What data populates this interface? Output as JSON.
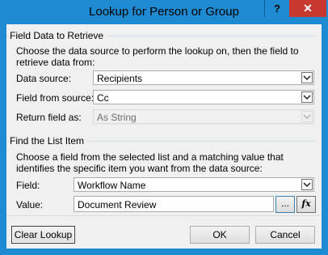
{
  "window": {
    "title": "Lookup for Person or Group",
    "help_label": "?",
    "close_label": "✕"
  },
  "field_data": {
    "section_title": "Field Data to Retrieve",
    "description": "Choose the data source to perform the lookup on, then the field to retrieve data from:",
    "data_source_label": "Data source:",
    "data_source_value": "Recipients",
    "field_from_source_label": "Field from source:",
    "field_from_source_value": "Cc",
    "return_field_label": "Return field as:",
    "return_field_value": "As String"
  },
  "find_list_item": {
    "section_title": "Find the List Item",
    "description": "Choose a field from the selected list and a matching value that identifies the specific item you want from the data source:",
    "field_label": "Field:",
    "field_value": "Workflow Name",
    "value_label": "Value:",
    "value_value": "Document Review",
    "browse_label": "...",
    "fx_label": "fx"
  },
  "buttons": {
    "clear_lookup": "Clear Lookup",
    "ok": "OK",
    "cancel": "Cancel"
  },
  "colors": {
    "title_bar": "#1d8ad1",
    "close_button": "#c7392f",
    "dialog_bg": "#f0f0f0"
  }
}
